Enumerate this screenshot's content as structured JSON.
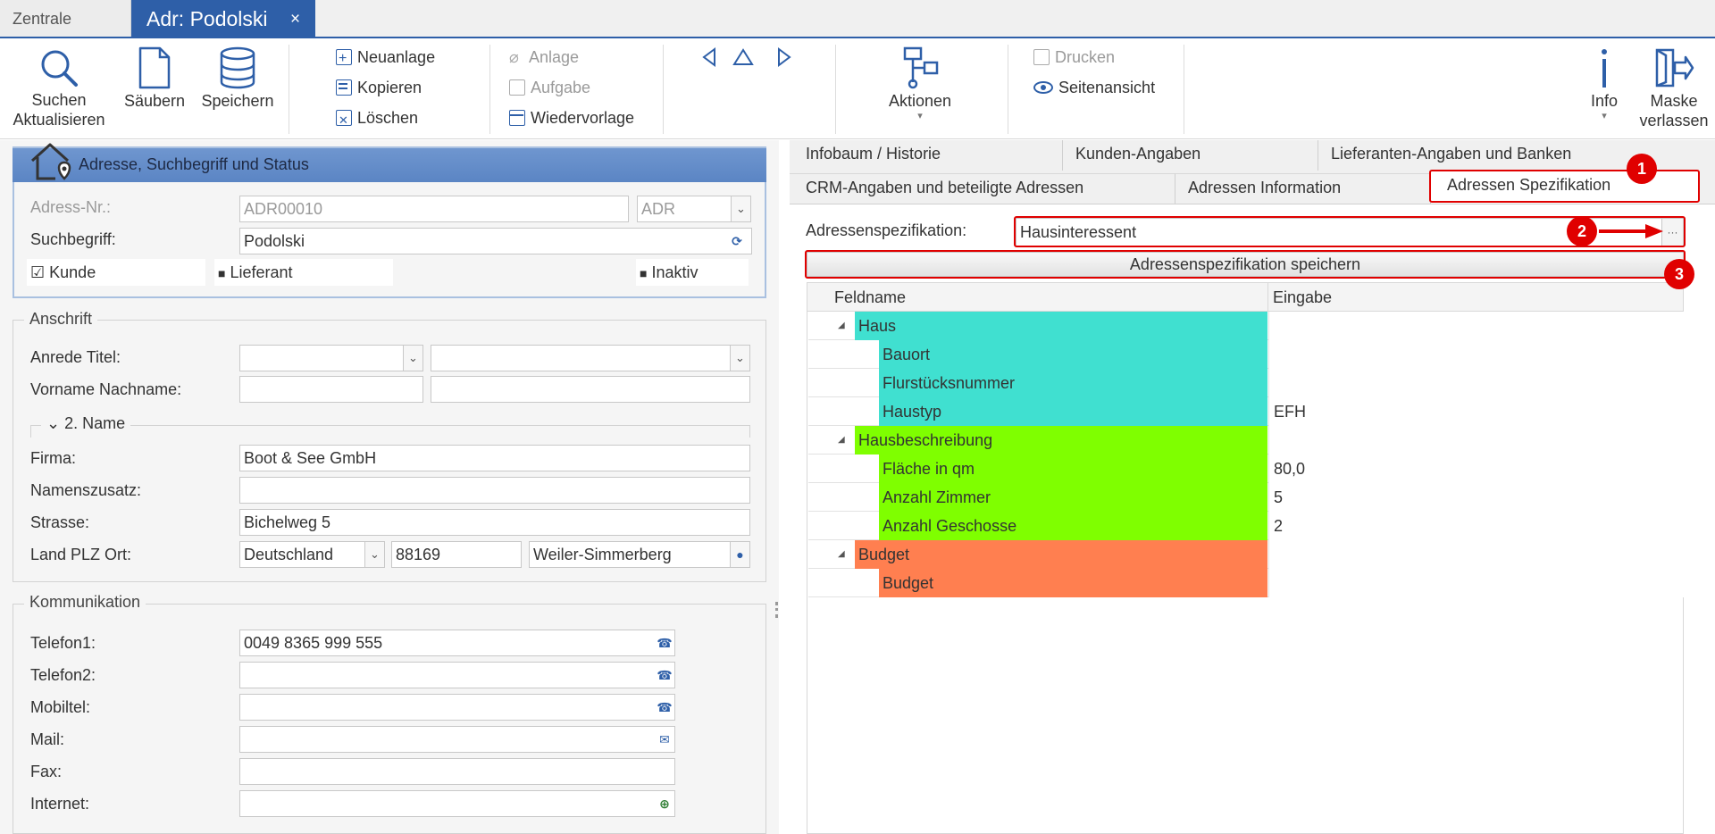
{
  "tabs": {
    "home": "Zentrale",
    "active": "Adr: Podolski",
    "close": "×"
  },
  "ribbon": {
    "search": "Suchen\nAktualisieren",
    "search_l1": "Suchen",
    "search_l2": "Aktualisieren",
    "clear": "Säubern",
    "save": "Speichern",
    "new": "Neuanlage",
    "copy": "Kopieren",
    "delete": "Löschen",
    "attachment": "Anlage",
    "task": "Aufgabe",
    "followup": "Wiedervorlage",
    "actions": "Aktionen",
    "print": "Drucken",
    "preview": "Seitenansicht",
    "info": "Info",
    "exit_l1": "Maske",
    "exit_l2": "verlassen"
  },
  "address_group": {
    "title": "Adresse, Suchbegriff und Status",
    "nr_label": "Adress-Nr.:",
    "nr_value": "ADR00010",
    "nr_type": "ADR",
    "search_label": "Suchbegriff:",
    "search_value": "Podolski",
    "customer": "Kunde",
    "supplier": "Lieferant",
    "inactive": "Inaktiv"
  },
  "anschrift": {
    "title": "Anschrift",
    "salutation_label": "Anrede Titel:",
    "name_label": "Vorname Nachname:",
    "second_name": "2. Name",
    "company_label": "Firma:",
    "company_value": "Boot & See GmbH",
    "suffix_label": "Namenszusatz:",
    "street_label": "Strasse:",
    "street_value": "Bichelweg 5",
    "country_label": "Land PLZ Ort:",
    "country_value": "Deutschland",
    "zip_value": "88169",
    "city_value": "Weiler-Simmerberg"
  },
  "kommunikation": {
    "title": "Kommunikation",
    "phone1_label": "Telefon1:",
    "phone1_value": "0049 8365 999 555",
    "phone2_label": "Telefon2:",
    "mobile_label": "Mobiltel:",
    "mail_label": "Mail:",
    "fax_label": "Fax:",
    "web_label": "Internet:"
  },
  "right_tabs": {
    "row1": [
      "Infobaum / Historie",
      "Kunden-Angaben",
      "Lieferanten-Angaben und Banken"
    ],
    "row2": [
      "CRM-Angaben und beteiligte Adressen",
      "Adressen Information",
      "Adressen Spezifikation"
    ]
  },
  "spec": {
    "label": "Adressenspezifikation:",
    "value": "Hausinteressent",
    "browse": "···",
    "save_button": "Adressenspezifikation speichern",
    "col_name": "Feldname",
    "col_value": "Eingabe"
  },
  "tree": [
    {
      "name": "Haus",
      "value": "",
      "level": 0,
      "color": "#40e0d0"
    },
    {
      "name": "Bauort",
      "value": "",
      "level": 1,
      "color": "#40e0d0"
    },
    {
      "name": "Flurstücksnummer",
      "value": "",
      "level": 1,
      "color": "#40e0d0"
    },
    {
      "name": "Haustyp",
      "value": "EFH",
      "level": 1,
      "color": "#40e0d0"
    },
    {
      "name": "Hausbeschreibung",
      "value": "",
      "level": 0,
      "color": "#7fff00"
    },
    {
      "name": "Fläche in qm",
      "value": "80,0",
      "level": 1,
      "color": "#7fff00"
    },
    {
      "name": "Anzahl Zimmer",
      "value": "5",
      "level": 1,
      "color": "#7fff00"
    },
    {
      "name": "Anzahl Geschosse",
      "value": "2",
      "level": 1,
      "color": "#7fff00"
    },
    {
      "name": "Budget",
      "value": "",
      "level": 0,
      "color": "#ff7f50"
    },
    {
      "name": "Budget",
      "value": "",
      "level": 1,
      "color": "#ff7f50"
    }
  ],
  "badges": [
    "1",
    "2",
    "3"
  ],
  "colors": {
    "accent": "#2e5fa8",
    "highlight": "#e00000"
  }
}
